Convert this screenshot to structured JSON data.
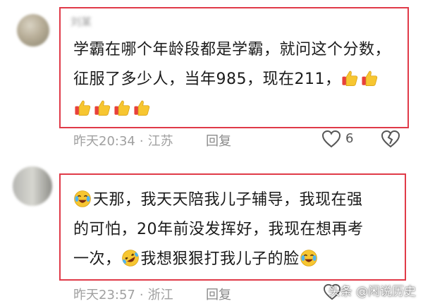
{
  "comments": [
    {
      "username": "刘某",
      "text_lines": [
        "学霸在哪个年龄段都是学霸，就问这个分数，",
        "征服了多少人，当年985，现在211，"
      ],
      "emoji_line_count": 4,
      "time": "昨天20:34",
      "location": "江苏",
      "reply_label": "回复",
      "like_count": "6"
    },
    {
      "username": "",
      "text_lines": [
        "天那，我天天陪我儿子辅导，我现在强",
        "的可怕，20年前没发挥好，我现在想再考",
        "一次，",
        "我想狠狠打我儿子的脸"
      ],
      "time": "昨天23:57",
      "location": "浙江",
      "reply_label": "回复"
    }
  ],
  "watermark": "头条 @闲说历史",
  "colors": {
    "highlight_box": "#e03a48",
    "meta_text": "#a0a0a0"
  },
  "icons": [
    "thumbs-up-emoji",
    "crying-laughing-emoji",
    "rolling-laughing-emoji",
    "heart-icon",
    "broken-heart-icon"
  ]
}
